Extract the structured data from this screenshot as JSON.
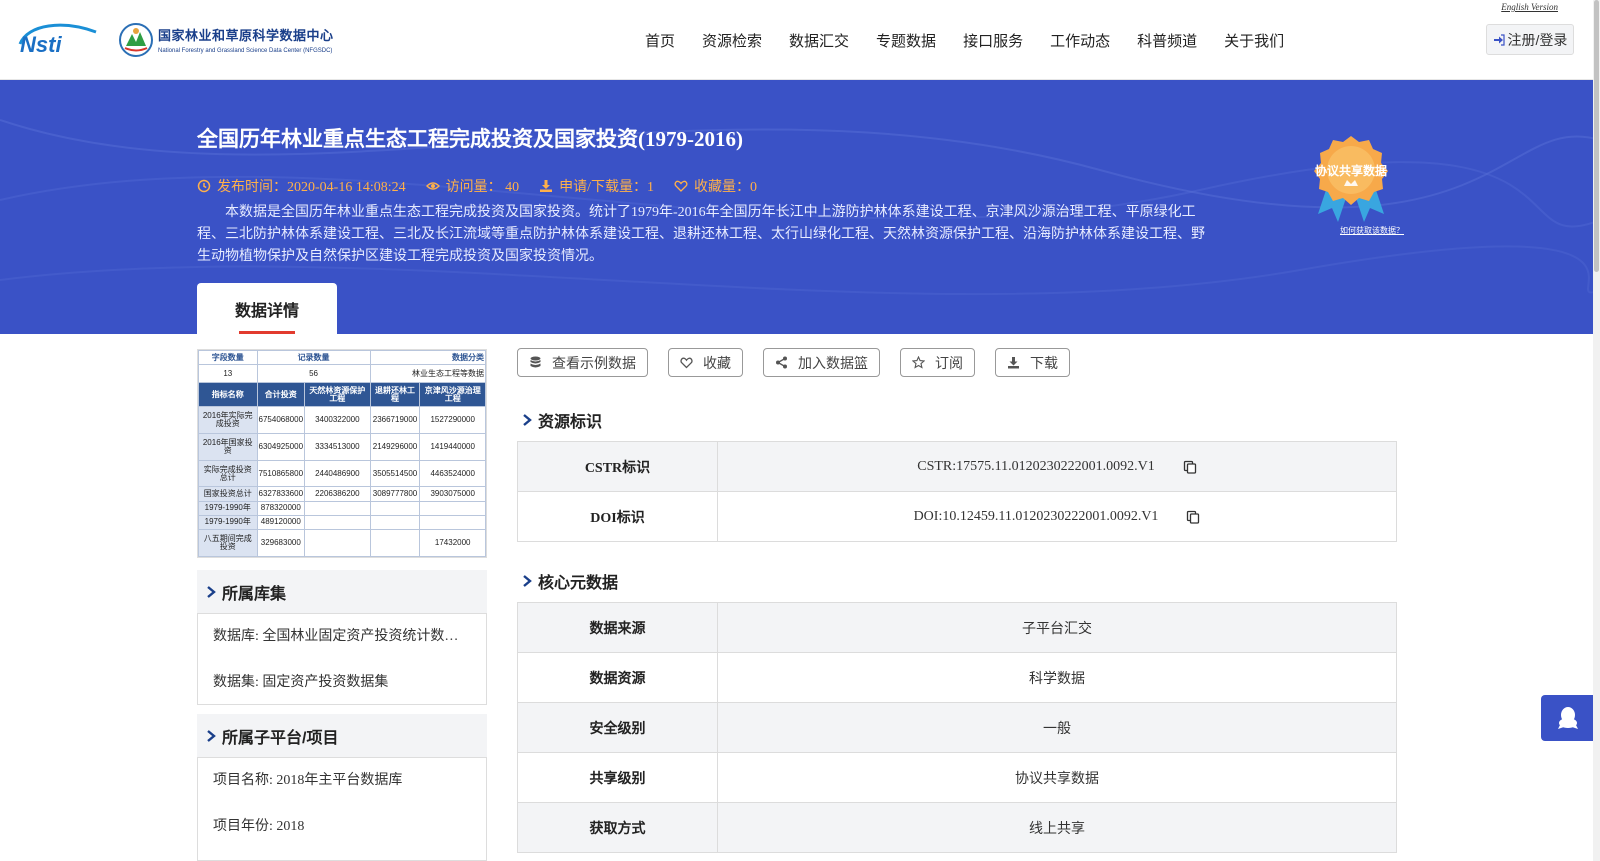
{
  "header": {
    "cstr_logo_text": "Nsti",
    "org_name_cn": "国家林业和草原科学数据中心",
    "org_name_en": "National Forestry and Grassland Science Data Center (NFGSDC)",
    "english_link": "English Version",
    "nav": [
      "首页",
      "资源检索",
      "数据汇交",
      "专题数据",
      "接口服务",
      "工作动态",
      "科普频道",
      "关于我们"
    ],
    "login_label": "注册/登录"
  },
  "dataset": {
    "title": "全国历年林业重点生态工程完成投资及国家投资(1979-2016)",
    "publish_time": "发布时间：2020-04-16 14:08:24",
    "visits": "访问量： 40",
    "downloads": "申请/下载量：1",
    "favorites": "收藏量：0",
    "description": "本数据是全国历年林业重点生态工程完成投资及国家投资。统计了1979年-2016年全国历年长江中上游防护林体系建设工程、京津风沙源治理工程、平原绿化工程、三北防护林体系建设工程、三北及长江流域等重点防护林体系建设工程、退耕还林工程、太行山绿化工程、天然林资源保护工程、沿海防护林体系建设工程、野生动物植物保护及自然保护区建设工程完成投资及国家投资情况。",
    "badge_text": "协议共享数据",
    "badge_link": "如何获取该数据？",
    "tab_detail": "数据详情"
  },
  "thumbnail": {
    "captions": [
      "字段数量",
      "记录数量",
      "数据分类"
    ],
    "counts": [
      "13",
      "56",
      "林业生态工程等数据"
    ],
    "headers": [
      "指标名称",
      "合计投资",
      "天然林资源保护工程",
      "退耕还林工程",
      "京津风沙源治理工程"
    ],
    "rows": [
      [
        "2016年实际完成投资",
        "6754068000",
        "3400322000",
        "2366719000",
        "1527290000"
      ],
      [
        "2016年国家投资",
        "6304925000",
        "3334513000",
        "2149296000",
        "1419440000"
      ],
      [
        "实际完成投资总计",
        "7510865800",
        "2440486900",
        "3505514500",
        "4463524000"
      ],
      [
        "国家投资总计",
        "6327833600",
        "2206386200",
        "3089777800",
        "3903075000"
      ],
      [
        "1979-1990年",
        "878320000",
        "",
        "",
        ""
      ],
      [
        "1979-1990年",
        "489120000",
        "",
        "",
        ""
      ],
      [
        "八五期间完成投资",
        "329683000",
        "",
        "",
        "17432000"
      ]
    ]
  },
  "library": {
    "title": "所属库集",
    "database": "数据库: 全国林业固定资产投资统计数据库",
    "dataset": "数据集: 固定资产投资数据集"
  },
  "subplatform": {
    "title": "所属子平台/项目",
    "project_name": "项目名称: 2018年主平台数据库",
    "project_year": "项目年份: 2018"
  },
  "actions": {
    "view_sample": "查看示例数据",
    "favorite": "收藏",
    "add_basket": "加入数据篮",
    "subscribe": "订阅",
    "download": "下载"
  },
  "resource_id": {
    "title": "资源标识",
    "rows": [
      {
        "key": "CSTR标识",
        "value": "CSTR:17575.11.0120230222001.0092.V1"
      },
      {
        "key": "DOI标识",
        "value": "DOI:10.12459.11.0120230222001.0092.V1"
      }
    ]
  },
  "core_meta": {
    "title": "核心元数据",
    "rows": [
      {
        "key": "数据来源",
        "value": "子平台汇交"
      },
      {
        "key": "数据资源",
        "value": "科学数据"
      },
      {
        "key": "安全级别",
        "value": "一般"
      },
      {
        "key": "共享级别",
        "value": "协议共享数据"
      },
      {
        "key": "获取方式",
        "value": "线上共享"
      }
    ]
  },
  "colors": {
    "banner": "#3a52c6",
    "accent_orange": "#ffb04a",
    "tab_underline": "#e23b2e",
    "logo_blue": "#1a3f8a"
  },
  "icons": [
    "clock-icon",
    "eye-icon",
    "download-icon",
    "heart-icon",
    "login-icon",
    "database-icon",
    "share-icon",
    "star-icon",
    "copy-icon",
    "chevron-right-icon",
    "qq-icon"
  ]
}
